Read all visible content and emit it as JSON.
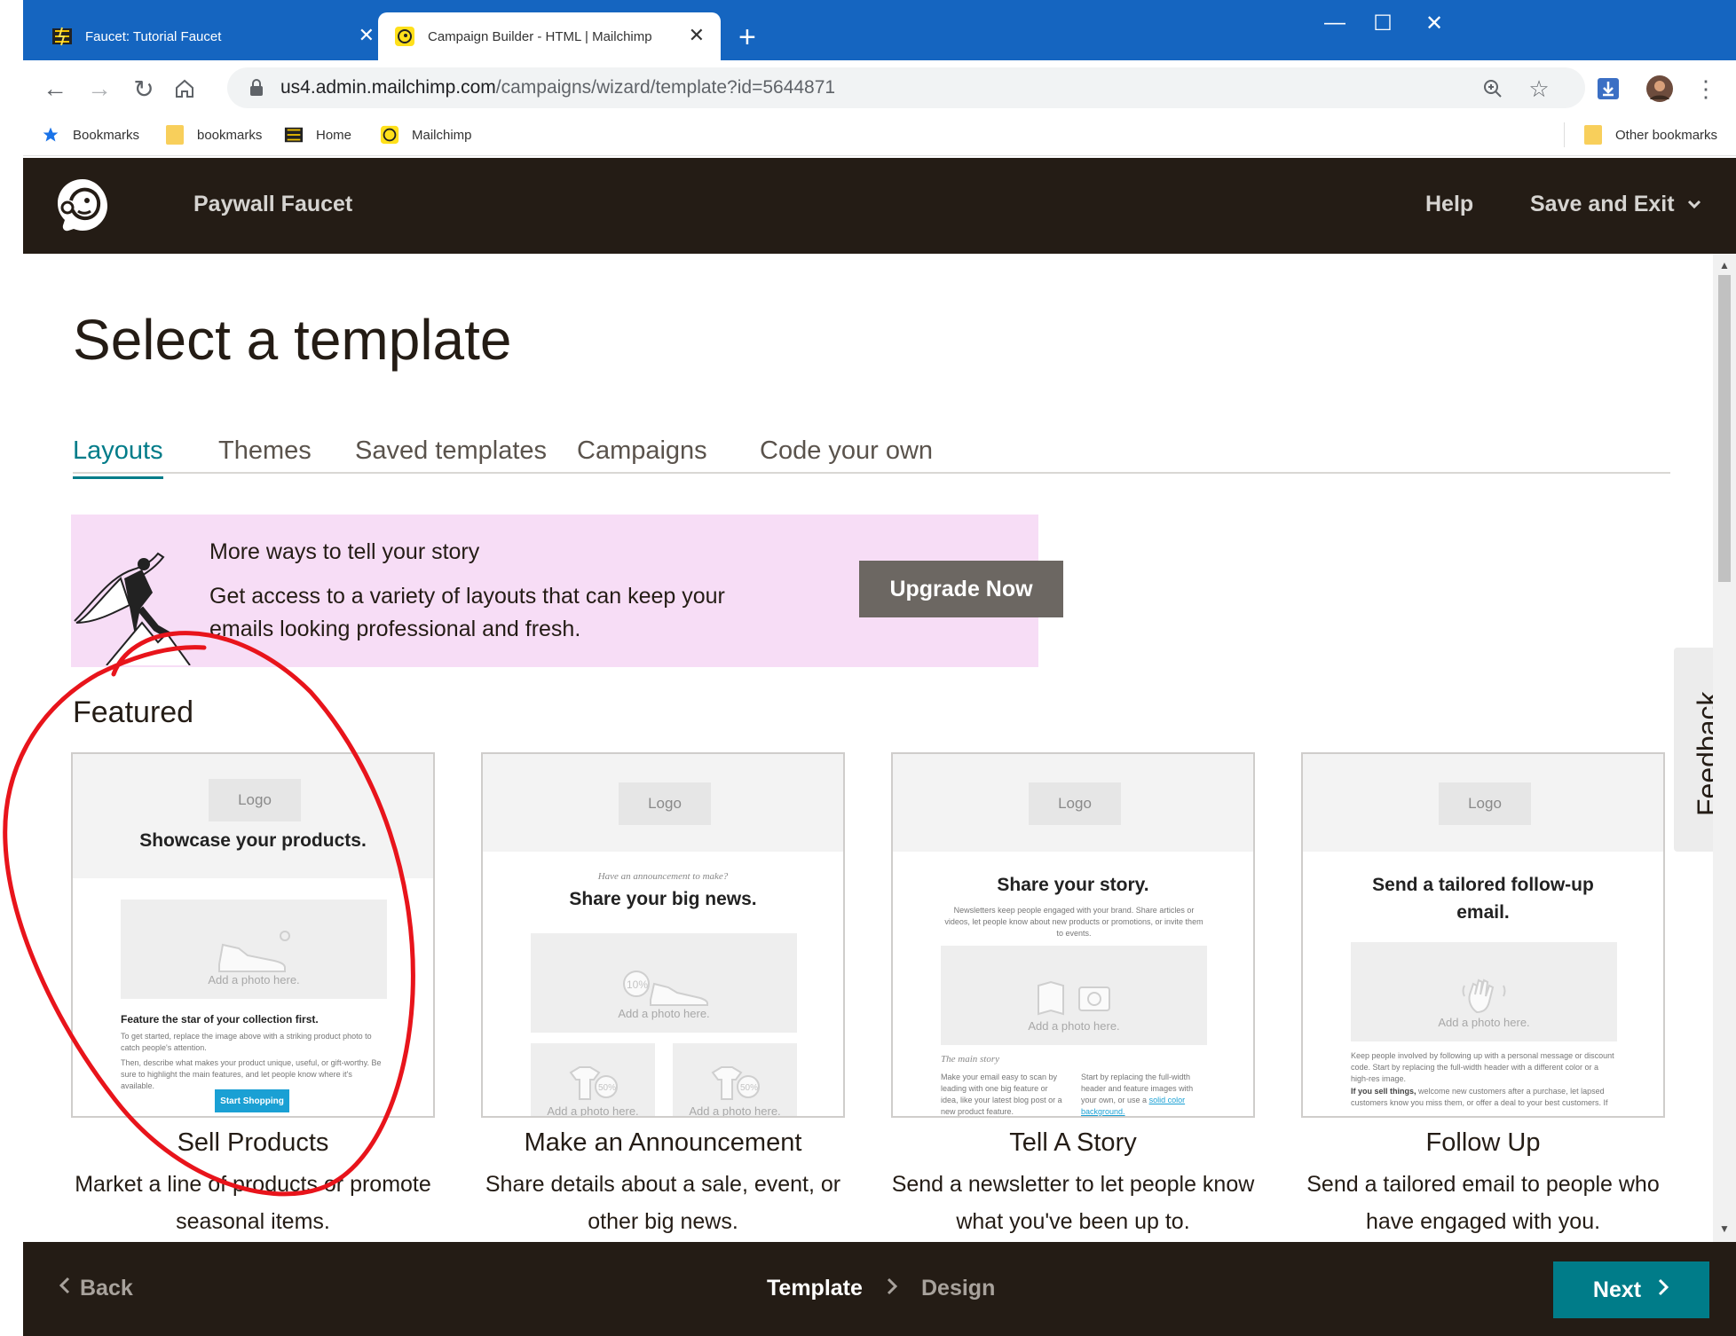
{
  "browser": {
    "tabs": [
      {
        "title": "Faucet: Tutorial Faucet",
        "close": "✕"
      },
      {
        "title": "Campaign Builder - HTML | Mailchimp",
        "close": "✕"
      }
    ],
    "new_tab": "+",
    "url_host": "us4.admin.mailchimp.com",
    "url_path": "/campaigns/wizard/template?id=5644871",
    "bookmarks": [
      {
        "label": "Bookmarks",
        "icon": "star-icon"
      },
      {
        "label": "bookmarks",
        "icon": "folder-icon"
      },
      {
        "label": "Home",
        "icon": "faucet-icon"
      },
      {
        "label": "Mailchimp",
        "icon": "mailchimp-icon"
      }
    ],
    "other_bookmarks": "Other bookmarks"
  },
  "header": {
    "account": "Paywall Faucet",
    "help": "Help",
    "save_exit": "Save and Exit"
  },
  "page": {
    "title": "Select a template",
    "tabs": [
      {
        "label": "Layouts",
        "active": true
      },
      {
        "label": "Themes",
        "active": false
      },
      {
        "label": "Saved templates",
        "active": false
      },
      {
        "label": "Campaigns",
        "active": false
      },
      {
        "label": "Code your own",
        "active": false
      }
    ]
  },
  "promo": {
    "heading": "More ways to tell your story",
    "body": "Get access to a variety of layouts that can keep your emails looking professional and fresh.",
    "button": "Upgrade Now"
  },
  "featured": {
    "title": "Featured",
    "cards": [
      {
        "name": "Sell Products",
        "description": "Market a line of products or promote seasonal items.",
        "preview": {
          "logo": "Logo",
          "headline": "Showcase your products.",
          "photo": "Add a photo here.",
          "subhead": "Feature the star of your collection first.",
          "body1": "To get started, replace the image above with a striking product photo to catch people's attention.",
          "body2": "Then, describe what makes your product unique, useful, or gift-worthy. Be sure to highlight the main features, and let people know where it's available.",
          "cta": "Start Shopping"
        }
      },
      {
        "name": "Make an Announcement",
        "description": "Share details about a sale, event, or other big news.",
        "preview": {
          "logo": "Logo",
          "kicker": "Have an announcement to make?",
          "headline": "Share your big news.",
          "photo": "Add a photo here.",
          "photo_small_1": "Add a photo here.",
          "photo_small_2": "Add a photo here.",
          "badge_1": "10%",
          "badge_2": "50%",
          "badge_3": "50%"
        }
      },
      {
        "name": "Tell A Story",
        "description": "Send a newsletter to let people know what you've been up to.",
        "preview": {
          "logo": "Logo",
          "headline": "Share your story.",
          "body": "Newsletters keep people engaged with your brand. Share articles or videos, let people know about new products or promotions, or invite them to events.",
          "photo": "Add a photo here.",
          "section": "The main story",
          "col1": "Make your email easy to scan by leading with one big feature or idea, like your latest blog post or a new product feature.",
          "col2": "Start by replacing the full-width header and feature images with your own, or use a",
          "col2_link": "solid color background."
        }
      },
      {
        "name": "Follow Up",
        "description": "Send a tailored email to people who have engaged with you.",
        "preview": {
          "logo": "Logo",
          "headline": "Send a tailored follow-up email.",
          "photo": "Add a photo here.",
          "body1": "Keep people involved by following up with a personal message or discount code. Start by replacing the full-width header with a different color or a high-res image.",
          "body2_bold": "If you sell things,",
          "body2": "welcome new customers after a purchase, let lapsed customers know you miss them, or offer a deal to your best customers. If"
        }
      }
    ]
  },
  "feedback": "Feedback",
  "footer": {
    "back": "Back",
    "step_current": "Template",
    "step_next": "Design",
    "next": "Next"
  },
  "colors": {
    "tabbar": "#1565c0",
    "header_bg": "#241c15",
    "accent": "#007c89",
    "promo_bg": "#f7ddf6",
    "annotation": "#e8141b"
  }
}
